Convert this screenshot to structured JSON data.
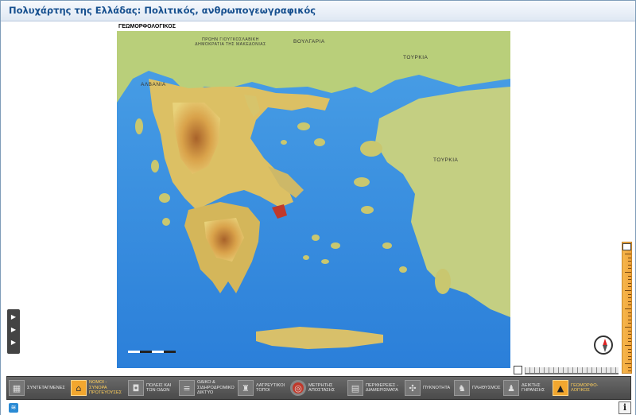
{
  "window": {
    "title": "Πολυχάρτης της Ελλάδας: Πολιτικός, ανθρωπογεωγραφικός"
  },
  "map": {
    "caption": "ΓΕΩΜΟΡΦΟΛΟΓΙΚΟΣ",
    "labels": {
      "fyrom": "ΠΡΩΗΝ ΓΙΟΥΓΚΟΣΛΑΒΙΚΗ ΔΗΜΟΚΡΑΤΙΑ ΤΗΣ ΜΑΚΕΔΟΝΙΑΣ",
      "bulgaria": "ΒΟΥΛΓΑΡΙΑ",
      "turkey_north": "ΤΟΥΡΚΙΑ",
      "albania": "ΑΛΒΑΝΙΑ",
      "turkey": "ΤΟΥΡΚΙΑ"
    }
  },
  "side_tab": {
    "arrows": [
      "▶",
      "▶",
      "▶"
    ]
  },
  "toolbar": {
    "items": [
      {
        "id": "coords",
        "label": "ΣΥΝΤΕΤΑΓΜΕΝΕΣ",
        "icon": "grid-icon",
        "glyph": "▦"
      },
      {
        "id": "prefectures",
        "label": "ΝΟΜΟΙ - ΣΥΝΟΡΑ ΠΡΩΤΕΥΟΥΣΕΣ",
        "icon": "prefectures-icon",
        "glyph": "⌂"
      },
      {
        "id": "cities",
        "label": "ΠΟΛΕΙΣ ΚΑΙ ΤΩΝ ΟΔΩΝ",
        "icon": "cities-icon",
        "glyph": "◘"
      },
      {
        "id": "roads",
        "label": "ΟΔΙΚΟ & ΣΙΔΗΡΟΔΡΟΜΙΚΟ ΔΙΚΤΥΟ",
        "icon": "roads-icon",
        "glyph": "≡"
      },
      {
        "id": "worship",
        "label": "ΛΑΤΡΕΥΤΙΚΟΙ ΤΟΠΟΙ",
        "icon": "worship-icon",
        "glyph": "♜"
      },
      {
        "id": "distance",
        "label": "ΜΕΤΡΗΤΗΣ ΑΠΟΣΤΑΣΗΣ",
        "icon": "distance-meter-icon",
        "glyph": "◎"
      },
      {
        "id": "regions",
        "label": "ΠΕΡΙΦΕΡΕΙΕΣ - ΔΙΑΜΕΡΙΣΜΑΤΑ",
        "icon": "regions-icon",
        "glyph": "▤"
      },
      {
        "id": "density",
        "label": "ΠΥΚΝΟΤΗΤΑ",
        "icon": "density-icon",
        "glyph": "✣"
      },
      {
        "id": "population",
        "label": "ΠΛΗΘΥΣΜΟΣ",
        "icon": "population-icon",
        "glyph": "♞"
      },
      {
        "id": "aging",
        "label": "ΔΕΙΚΤΗΣ ΓΗΡΑΝΣΗΣ",
        "icon": "aging-index-icon",
        "glyph": "♟"
      },
      {
        "id": "geomorph",
        "label": "ΓΕΩΜΟΡΦΟ-ΛΟΓΙΚΟΣ",
        "icon": "geomorphology-icon",
        "glyph": "▲"
      }
    ],
    "active": "geomorph"
  },
  "status": {
    "info": "i"
  }
}
